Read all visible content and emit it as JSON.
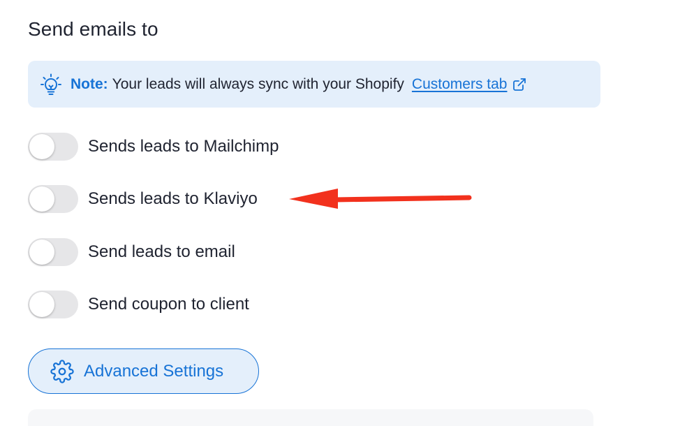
{
  "section": {
    "title": "Send emails to"
  },
  "note": {
    "label": "Note:",
    "text": "Your leads will always sync with your Shopify",
    "link_text": "Customers tab",
    "icon": "lightbulb-icon",
    "link_icon": "external-link-icon"
  },
  "toggles": [
    {
      "label": "Sends leads to Mailchimp",
      "enabled": false
    },
    {
      "label": "Sends leads to Klaviyo",
      "enabled": false
    },
    {
      "label": "Send leads to email",
      "enabled": false
    },
    {
      "label": "Send coupon to client",
      "enabled": false
    }
  ],
  "advanced_button": {
    "label": "Advanced Settings",
    "icon": "gear-icon"
  },
  "colors": {
    "accent": "#1773d6",
    "note_background": "#e4effb",
    "toggle_off": "#e6e6e8",
    "annotation_arrow": "#f2311d"
  }
}
